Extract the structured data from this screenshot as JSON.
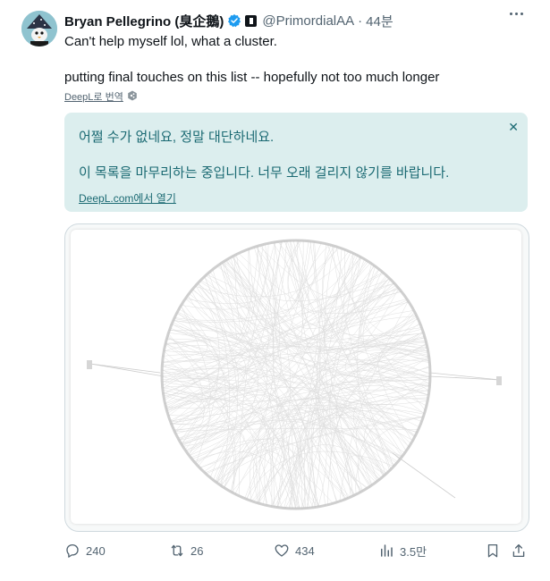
{
  "tweet": {
    "author_name": "Bryan Pellegrino (臭企鵝)",
    "handle": "@PrimordialAA",
    "separator": "·",
    "time": "44분",
    "lines": [
      "Can't help myself lol, what a cluster.",
      "putting final touches on this list -- hopefully not too much longer"
    ]
  },
  "translation": {
    "link_label": "DeepL로 번역",
    "lines": [
      "어쩔 수가 없네요, 정말 대단하네요.",
      "이 목록을 마무리하는 중입니다. 너무 오래 걸리지 않기를 바랍니다."
    ],
    "source_link": "DeepL.com에서 열기"
  },
  "actions": {
    "replies": "240",
    "reposts": "26",
    "likes": "434",
    "views": "3.5만"
  },
  "colors": {
    "accent": "#1d9bf0",
    "translation_bg": "#dceeee",
    "translation_text": "#1b6a73",
    "muted": "#536471"
  },
  "icons": [
    "more-icon",
    "verified-icon",
    "affiliate-icon",
    "deepl-icon",
    "close-icon",
    "reply-icon",
    "repost-icon",
    "like-icon",
    "views-icon",
    "bookmark-icon",
    "share-icon"
  ]
}
